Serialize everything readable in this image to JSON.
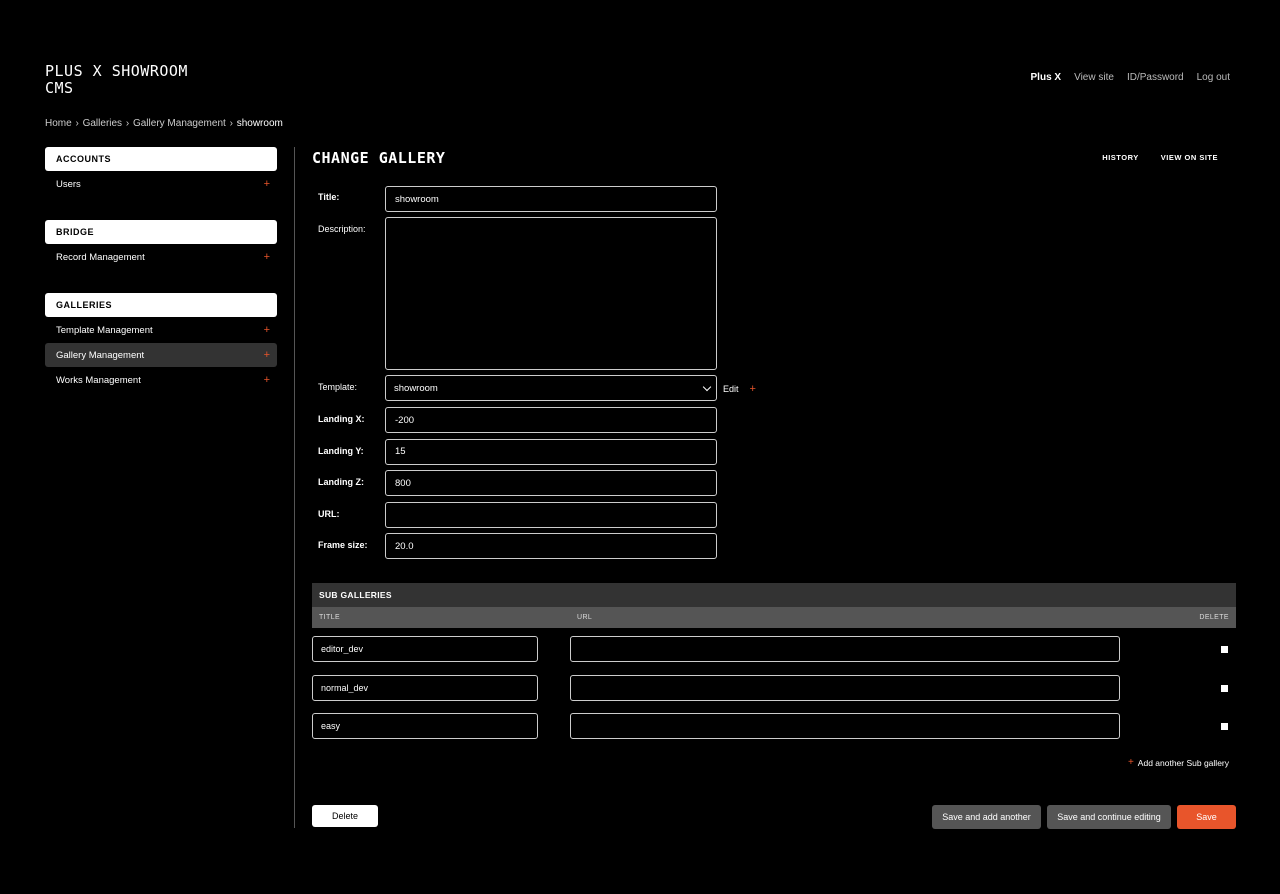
{
  "branding": {
    "line1": "PLUS X SHOWROOM",
    "line2": "CMS"
  },
  "usertools": {
    "user": "Plus X",
    "view_site": "View site",
    "password": "ID/Password",
    "logout": "Log out"
  },
  "breadcrumbs": {
    "home": "Home",
    "sep": "›",
    "galleries": "Galleries",
    "gallery_management": "Gallery Management",
    "current": "showroom"
  },
  "sidebar": {
    "modules": [
      {
        "header": "ACCOUNTS",
        "items": [
          {
            "label": "Users",
            "add": "+"
          }
        ]
      },
      {
        "header": "BRIDGE",
        "items": [
          {
            "label": "Record Management",
            "add": "+"
          }
        ]
      },
      {
        "header": "GALLERIES",
        "items": [
          {
            "label": "Template Management",
            "add": "+"
          },
          {
            "label": "Gallery Management",
            "add": "+"
          },
          {
            "label": "Works Management",
            "add": "+"
          }
        ]
      }
    ]
  },
  "content": {
    "title": "CHANGE GALLERY",
    "history": "HISTORY",
    "view_on_site": "VIEW ON SITE",
    "fields": {
      "title": {
        "label": "Title:",
        "value": "showroom"
      },
      "description": {
        "label": "Description:",
        "value": ""
      },
      "template": {
        "label": "Template:",
        "value": "showroom",
        "edit": "Edit",
        "add": "+"
      },
      "landing_x": {
        "label": "Landing X:",
        "value": "-200"
      },
      "landing_y": {
        "label": "Landing Y:",
        "value": "15"
      },
      "landing_z": {
        "label": "Landing Z:",
        "value": "800"
      },
      "url": {
        "label": "URL:",
        "value": ""
      },
      "frame_size": {
        "label": "Frame size:",
        "value": "20.0"
      }
    },
    "inline": {
      "heading": "SUB GALLERIES",
      "columns": {
        "title": "TITLE",
        "url": "URL",
        "delete": "DELETE"
      },
      "rows": [
        {
          "title": "editor_dev",
          "url": ""
        },
        {
          "title": "normal_dev",
          "url": ""
        },
        {
          "title": "easy",
          "url": ""
        }
      ],
      "add_another": "Add another Sub gallery",
      "add_icon": "+"
    },
    "buttons": {
      "delete": "Delete",
      "save_add": "Save and add another",
      "save_continue": "Save and continue editing",
      "save": "Save"
    }
  },
  "colors": {
    "accent": "#e8552b",
    "background": "#000000",
    "panel": "#333333"
  }
}
